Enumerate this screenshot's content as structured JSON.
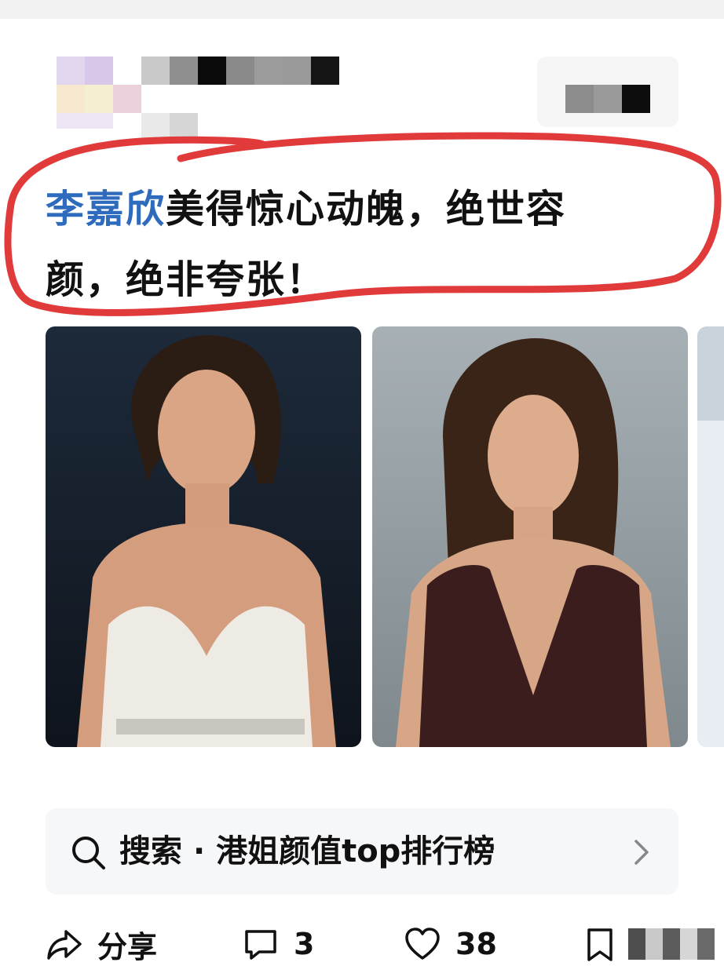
{
  "post": {
    "title_highlight": "李嘉欣",
    "title_line1_rest": "美得惊心动魄，绝世容",
    "title_line2": "颜，绝非夸张！"
  },
  "images": [
    {
      "alt": "photo-white-dress"
    },
    {
      "alt": "photo-dark-dress"
    },
    {
      "alt": "photo-partial"
    }
  ],
  "search": {
    "prefix": "搜索",
    "dot": "·",
    "query": "港姐颜值top排行榜"
  },
  "actions": {
    "share_label": "分享",
    "comment_count": "3",
    "like_count": "38"
  },
  "colors": {
    "highlight": "#2f6bbd",
    "annotation": "#e03a3a"
  }
}
